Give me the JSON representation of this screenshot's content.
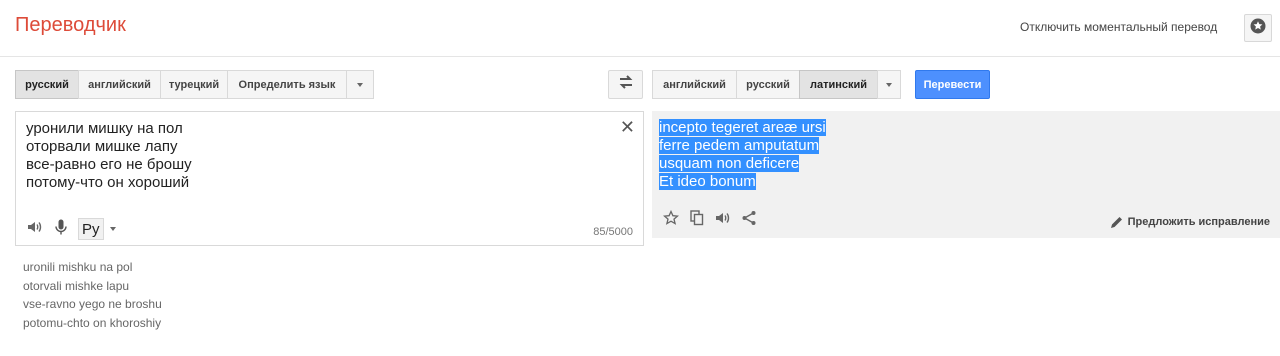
{
  "header": {
    "title": "Переводчик",
    "instant_toggle": "Отключить моментальный перевод",
    "star_icon": "star-icon"
  },
  "source_langs": {
    "items": [
      "русский",
      "английский",
      "турецкий",
      "Определить язык"
    ],
    "selected": "русский"
  },
  "target_langs": {
    "items": [
      "английский",
      "русский",
      "латинский"
    ],
    "selected": "латинский"
  },
  "translate_button": "Перевести",
  "source": {
    "lines": [
      "уронили мишку на пол",
      "оторвали мишке лапу",
      "все-равно его не брошу",
      "потому-что он хороший"
    ],
    "input_method": "Ру",
    "char_count": "85/5000"
  },
  "transliteration": [
    "uronili mishku na pol",
    "otorvali mishke lapu",
    "vse-ravno yego ne broshu",
    "potomu-chto on khoroshiy"
  ],
  "target": {
    "lines": [
      "incepto tegeret areæ ursi",
      "ferre pedem amputatum",
      "usquam non deficere",
      "Et ideo bonum"
    ],
    "suggest_edit": "Предложить исправление"
  },
  "colors": {
    "brand": "#dd4b39",
    "primary_button": "#4d90fe",
    "selection": "#3390ff"
  }
}
